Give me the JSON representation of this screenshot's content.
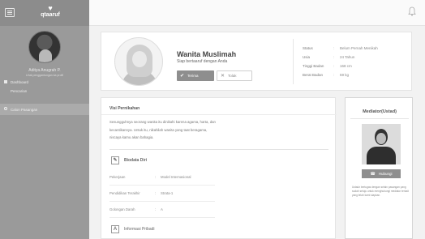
{
  "app": {
    "logo_text": "qtaaruf"
  },
  "sidebar": {
    "profile_name": "Aditya Anugrah P.",
    "profile_sub": "Lihat penggantungan ka profil",
    "menu": [
      {
        "label": "Dashboard"
      },
      {
        "label": "Pencarian"
      },
      {
        "label": "Calon Pasangan"
      }
    ]
  },
  "profile_card": {
    "name": "Wanita Muslimah",
    "subtitle": "Siap bertaaruf dengan Anda",
    "accept_label": "Terima",
    "reject_label": "Tolak",
    "stats": [
      {
        "key": "Status",
        "value": "Belum Pernah Menikah"
      },
      {
        "key": "Usia",
        "value": "24 Tahun"
      },
      {
        "key": "Tinggi Badan",
        "value": "168 cm"
      },
      {
        "key": "Berat Badan",
        "value": "59 kg"
      }
    ]
  },
  "main": {
    "visi_title": "Visi Pernikahan",
    "visi_lines": [
      "Sesungguhnya seorang wanita itu dinikahi karena agama, harta, dan",
      "kecantikannya. Untuk itu, nikahilah wanita yang taat beragama,",
      "niscaya kamu akan bahagia."
    ],
    "biodata_title": "Biodata Diri",
    "biodata": [
      {
        "key": "Pekerjaan",
        "value": "Model Internasional"
      },
      {
        "key": "Pendidikan Terakhir",
        "value": "Strata-1"
      },
      {
        "key": "Golongan Darah",
        "value": "A"
      }
    ],
    "info_title": "Informasi Pribadi"
  },
  "mediator": {
    "title": "Mediator(Ustad)",
    "button_label": "Hubungi",
    "description": "Ustadz bertugas dengan selain pasangan yang sudah setuju untuk menghubungi mediator terkait yang telah kami siapkan."
  }
}
